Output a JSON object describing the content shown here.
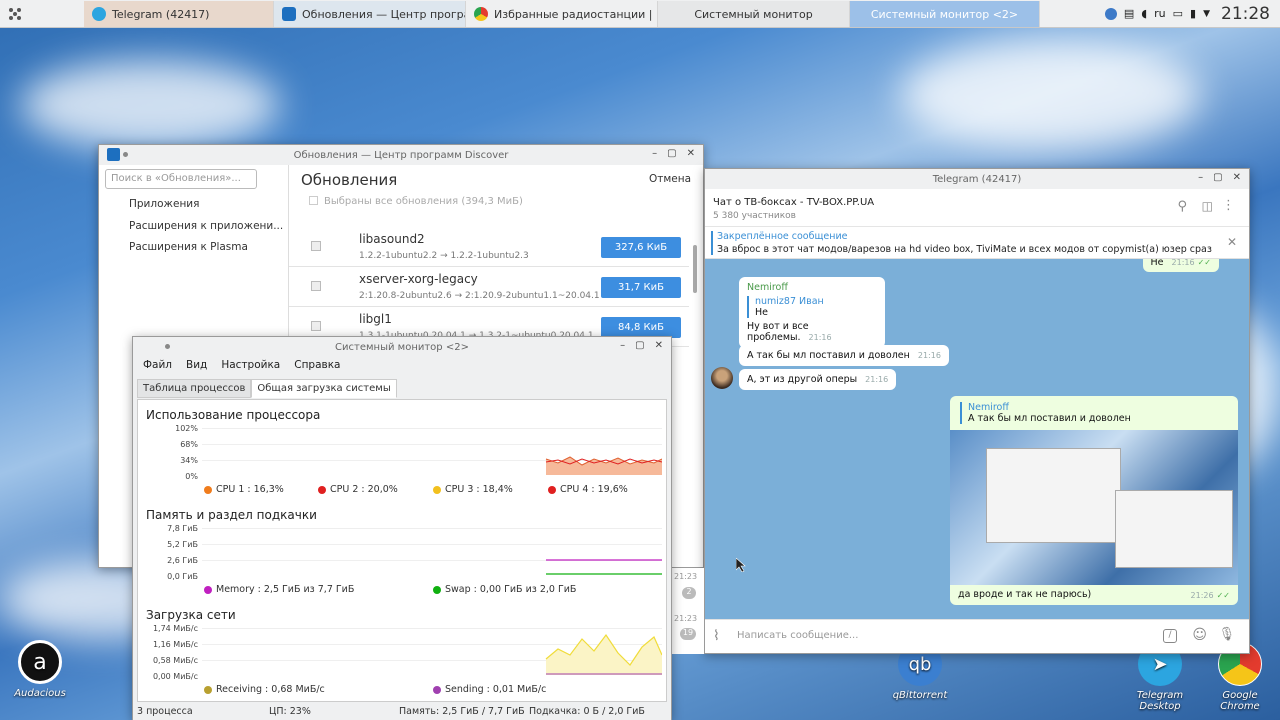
{
  "taskbar": {
    "tasks": [
      {
        "label": "Telegram (42417)",
        "color": "#2ca5e0"
      },
      {
        "label": "Обновления — Центр программ ...",
        "color": "#1d6fbf"
      },
      {
        "label": "Избранные радиостанции | Ради...",
        "color": "#e33b2e"
      },
      {
        "label": "Системный монитор",
        "color": "#888888"
      },
      {
        "label": "Системный монитор <2>",
        "color": "#888888"
      }
    ],
    "tray_lang": "ru",
    "clock": "21:28"
  },
  "desktop_icons": [
    {
      "label": "Audacious",
      "icon": "audacious-icon"
    },
    {
      "label": "qBittorrent",
      "icon": "qbittorrent-icon"
    },
    {
      "label": "Telegram Desktop",
      "icon": "telegram-icon"
    },
    {
      "label": "Google Chrome",
      "icon": "chrome-icon"
    }
  ],
  "discover": {
    "title": "Обновления — Центр программ Discover",
    "search_placeholder": "Поиск в «Обновления»...",
    "sidebar": [
      "Приложения",
      "Расширения к приложени...",
      "Расширения к Plasma"
    ],
    "page_title": "Обновления",
    "cancel": "Отмена",
    "select_all": "Выбраны все обновления (394,3 МиБ)",
    "updates": [
      {
        "name": "libasound2",
        "version": "1.2.2-1ubuntu2.2 → 1.2.2-1ubuntu2.3",
        "size": "327,6 КиБ"
      },
      {
        "name": "xserver-xorg-legacy",
        "version": "2:1.20.8-2ubuntu2.6 → 2:1.20.9-2ubuntu1.1~20.04.1",
        "size": "31,7 КиБ"
      },
      {
        "name": "libgl1",
        "version": "1.3.1-1ubuntu0.20.04.1 → 1.3.2-1~ubuntu0.20.04.1",
        "size": "84,8 КиБ"
      }
    ]
  },
  "telegram": {
    "title": "Telegram (42417)",
    "chat_name": "Чат о ТВ-боксах - TV-BOX.PP.UA",
    "members": "5 380 участников",
    "pinned_label": "Закреплённое сообщение",
    "pinned_text": "За вброс в этот чат модов/варезов на hd video box, TiviMate  и всех модов от copymist(а) юзер сразу может улететь...",
    "messages": {
      "top_out": {
        "text": "Не",
        "time": "21:16"
      },
      "m1": {
        "author": "Nemiroff",
        "quote_author": "numiz87 Иван",
        "quote_text": "Не",
        "text": "Ну вот и все проблемы.",
        "time": "21:16"
      },
      "m2": {
        "text": "А так бы мл поставил и доволен",
        "time": "21:16"
      },
      "m3": {
        "text": "А, эт из другой оперы",
        "time": "21:16"
      },
      "m4": {
        "quote_author": "Nemiroff",
        "quote_text": "А так бы мл поставил и доволен",
        "text": "да вроде и так не парюсь)",
        "time": "21:26"
      }
    },
    "input_placeholder": "Написать сообщение...",
    "side_times": [
      "21:23",
      "21:23"
    ],
    "side_badges": [
      "2",
      "19"
    ]
  },
  "sysmon": {
    "title": "Системный монитор <2>",
    "menu": [
      "Файл",
      "Вид",
      "Настройка",
      "Справка"
    ],
    "tabs": [
      "Таблица процессов",
      "Общая загрузка системы"
    ],
    "cpu": {
      "title": "Использование процессора",
      "yticks": [
        "102%",
        "68%",
        "34%",
        "0%"
      ],
      "legend": [
        {
          "label": "CPU 1 : 16,3%",
          "color": "#f07c1c"
        },
        {
          "label": "CPU 2 : 20,0%",
          "color": "#e02020"
        },
        {
          "label": "CPU 3 : 18,4%",
          "color": "#f2c01e"
        },
        {
          "label": "CPU 4 : 19,6%",
          "color": "#e02020"
        }
      ]
    },
    "mem": {
      "title": "Память и раздел подкачки",
      "yticks": [
        "7,8 ГиБ",
        "5,2 ГиБ",
        "2,6 ГиБ",
        "0,0 ГиБ"
      ],
      "legend": [
        {
          "label": "Memory : 2,5 ГиБ из 7,7 ГиБ",
          "color": "#c020c0"
        },
        {
          "label": "Swap : 0,00 ГиБ из 2,0 ГиБ",
          "color": "#10b010"
        }
      ]
    },
    "net": {
      "title": "Загрузка сети",
      "yticks": [
        "1,74 МиБ/с",
        "1,16 МиБ/с",
        "0,58 МиБ/с",
        "0,00 МиБ/с"
      ],
      "legend": [
        {
          "label": "Receiving : 0,68 МиБ/с",
          "color": "#b8a030"
        },
        {
          "label": "Sending : 0,01 МиБ/с",
          "color": "#a040b0"
        }
      ]
    },
    "status": [
      "3 процесса",
      "ЦП: 23%",
      "Память: 2,5 ГиБ / 7,7 ГиБ",
      "Подкачка: 0 Б / 2,0 ГиБ"
    ]
  }
}
